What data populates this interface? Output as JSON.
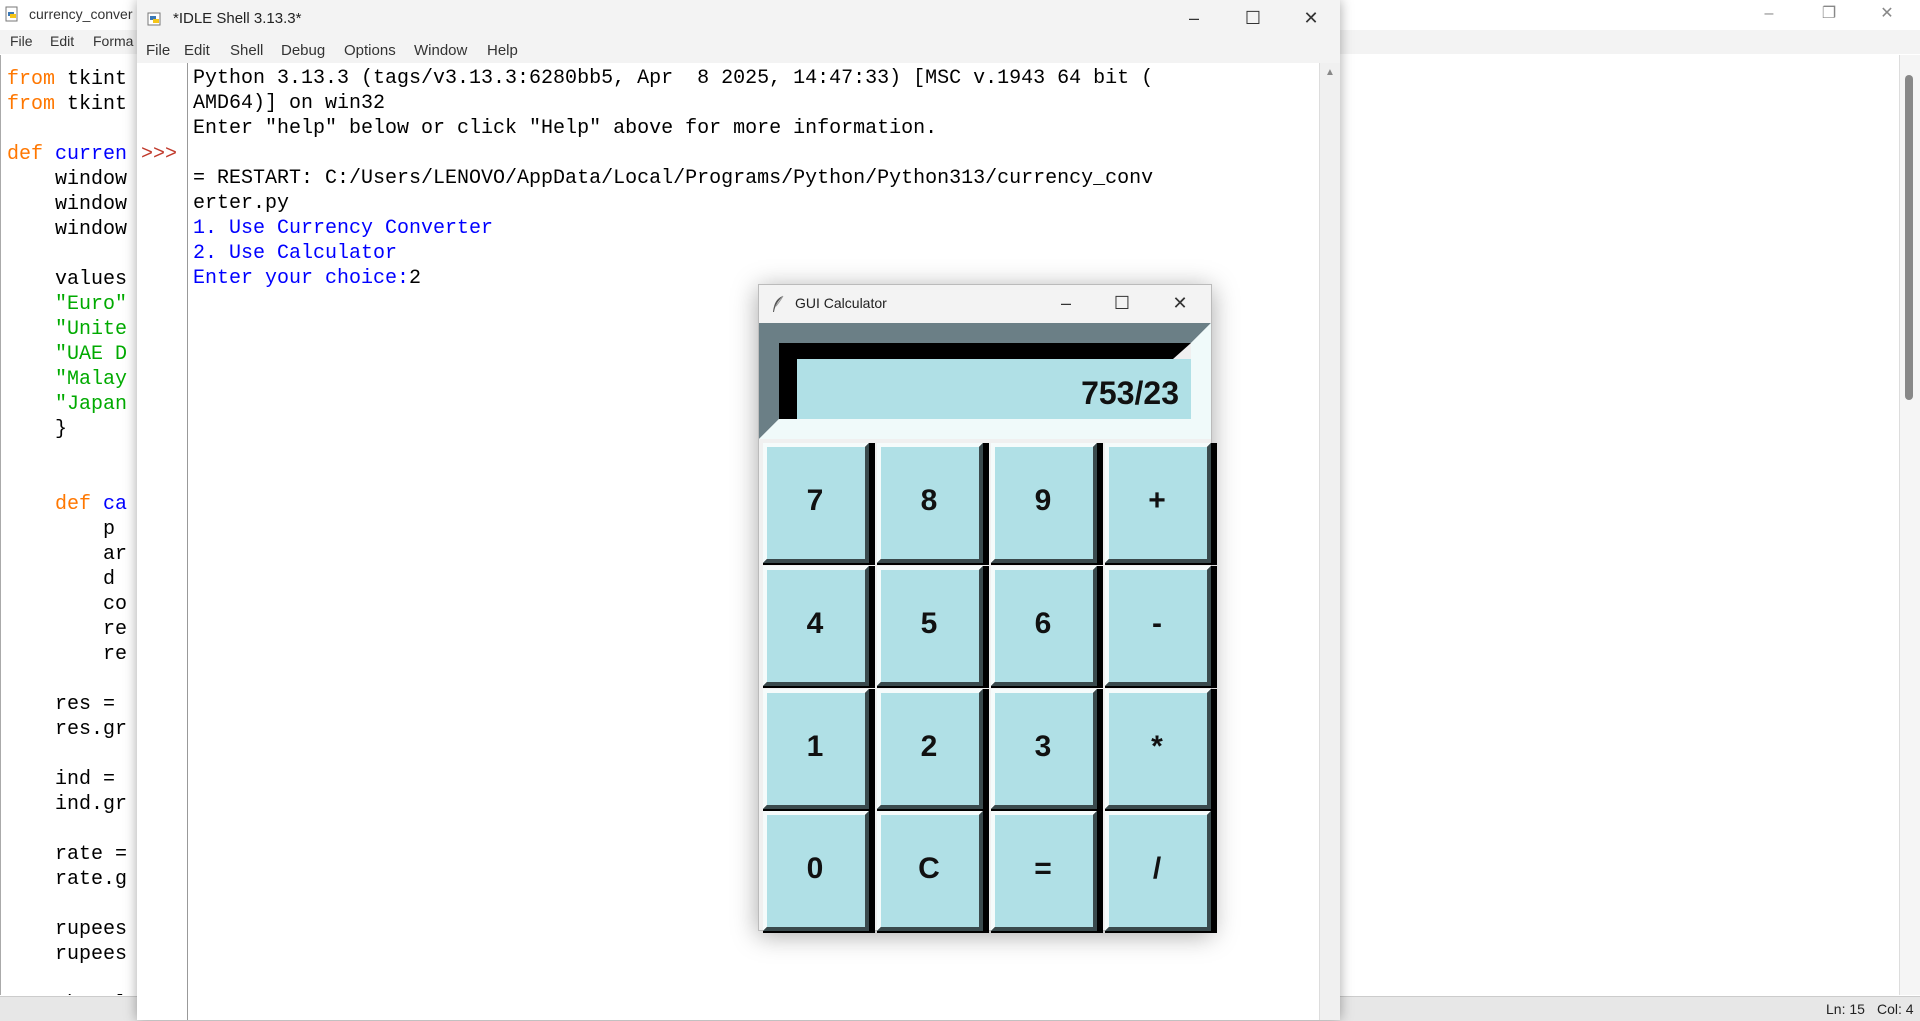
{
  "editor": {
    "title": "currency_conver",
    "menu": [
      "File",
      "Edit",
      "Forma"
    ],
    "code_lines": [
      {
        "parts": [
          {
            "t": "from ",
            "c": "kw"
          },
          {
            "t": "tkint",
            "c": "df"
          }
        ]
      },
      {
        "parts": [
          {
            "t": "from ",
            "c": "kw"
          },
          {
            "t": "tkint",
            "c": "df"
          }
        ]
      },
      {
        "parts": []
      },
      {
        "parts": [
          {
            "t": "def ",
            "c": "kw"
          },
          {
            "t": "curren",
            "c": "fn"
          }
        ]
      },
      {
        "parts": [
          {
            "t": "    window",
            "c": "df"
          }
        ]
      },
      {
        "parts": [
          {
            "t": "    window",
            "c": "df"
          }
        ]
      },
      {
        "parts": [
          {
            "t": "    window",
            "c": "df"
          }
        ]
      },
      {
        "parts": []
      },
      {
        "parts": [
          {
            "t": "    values",
            "c": "df"
          }
        ]
      },
      {
        "parts": [
          {
            "t": "    \"Euro\"",
            "c": "st"
          }
        ]
      },
      {
        "parts": [
          {
            "t": "    \"Unite",
            "c": "st"
          }
        ]
      },
      {
        "parts": [
          {
            "t": "    \"UAE D",
            "c": "st"
          }
        ]
      },
      {
        "parts": [
          {
            "t": "    \"Malay",
            "c": "st"
          }
        ]
      },
      {
        "parts": [
          {
            "t": "    \"Japan",
            "c": "st"
          }
        ]
      },
      {
        "parts": [
          {
            "t": "    }",
            "c": "df"
          }
        ]
      },
      {
        "parts": []
      },
      {
        "parts": []
      },
      {
        "parts": [
          {
            "t": "    def ",
            "c": "kw"
          },
          {
            "t": "ca",
            "c": "fn"
          }
        ]
      },
      {
        "parts": [
          {
            "t": "        p",
            "c": "df"
          }
        ]
      },
      {
        "parts": [
          {
            "t": "        ar",
            "c": "df"
          }
        ]
      },
      {
        "parts": [
          {
            "t": "        d",
            "c": "df"
          }
        ]
      },
      {
        "parts": [
          {
            "t": "        co",
            "c": "df"
          }
        ]
      },
      {
        "parts": [
          {
            "t": "        re",
            "c": "df"
          }
        ]
      },
      {
        "parts": [
          {
            "t": "        re",
            "c": "df"
          }
        ]
      },
      {
        "parts": []
      },
      {
        "parts": [
          {
            "t": "    res = ",
            "c": "df"
          }
        ]
      },
      {
        "parts": [
          {
            "t": "    res.gr",
            "c": "df"
          }
        ]
      },
      {
        "parts": []
      },
      {
        "parts": [
          {
            "t": "    ind = ",
            "c": "df"
          }
        ]
      },
      {
        "parts": [
          {
            "t": "    ind.gr",
            "c": "df"
          }
        ]
      },
      {
        "parts": []
      },
      {
        "parts": [
          {
            "t": "    rate =",
            "c": "df"
          }
        ]
      },
      {
        "parts": [
          {
            "t": "    rate.g",
            "c": "df"
          }
        ]
      },
      {
        "parts": []
      },
      {
        "parts": [
          {
            "t": "    rupees",
            "c": "df"
          }
        ]
      },
      {
        "parts": [
          {
            "t": "    rupees",
            "c": "df"
          }
        ]
      },
      {
        "parts": []
      },
      {
        "parts": [
          {
            "t": "    gb = l",
            "c": "df"
          }
        ]
      }
    ],
    "status": {
      "line": "Ln: 15",
      "col": "Col: 4"
    }
  },
  "shell": {
    "title": "*IDLE Shell 3.13.3*",
    "menu": [
      "File",
      "Edit",
      "Shell",
      "Debug",
      "Options",
      "Window",
      "Help"
    ],
    "prompt": ">>>",
    "lines": [
      {
        "text": "Python 3.13.3 (tags/v3.13.3:6280bb5, Apr  8 2025, 14:47:33) [MSC v.1943 64 bit (",
        "cls": "black"
      },
      {
        "text": "AMD64)] on win32",
        "cls": "black"
      },
      {
        "text": "Enter \"help\" below or click \"Help\" above for more information.",
        "cls": "black"
      },
      {
        "text": "",
        "cls": "black"
      },
      {
        "text": "= RESTART: C:/Users/LENOVO/AppData/Local/Programs/Python/Python313/currency_conv",
        "cls": "black"
      },
      {
        "text": "erter.py",
        "cls": "black"
      },
      {
        "text": "1. Use Currency Converter",
        "cls": "blue"
      },
      {
        "text": "2. Use Calculator",
        "cls": "blue"
      },
      {
        "text": "Enter your choice:",
        "cls": "blue",
        "input": "2"
      }
    ]
  },
  "calculator": {
    "title": "GUI Calculator",
    "display": "753/23",
    "keys": [
      "7",
      "8",
      "9",
      "+",
      "4",
      "5",
      "6",
      "-",
      "1",
      "2",
      "3",
      "*",
      "0",
      "C",
      "=",
      "/"
    ],
    "key_names": [
      "seven",
      "eight",
      "nine",
      "plus",
      "four",
      "five",
      "six",
      "minus",
      "one",
      "two",
      "three",
      "multiply",
      "zero",
      "clear",
      "equals",
      "divide"
    ],
    "colors": {
      "key_face": "#b0e0e6",
      "display_bg": "#b0e0e6"
    }
  }
}
